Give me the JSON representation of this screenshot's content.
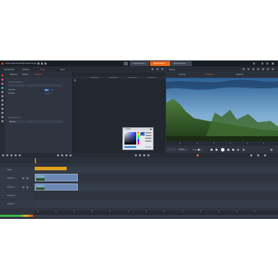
{
  "colors": {
    "accent": "#e86a1c",
    "panel": "#2e3440",
    "titlebar": "#1a1e25",
    "timeline_track_alt": "#353c49",
    "clip_title": "#e2a31c",
    "clip_video": "#6c88b5"
  },
  "menu": [
    "Datei",
    "Bearbeiten",
    "Einstellungen"
  ],
  "main_tabs": [
    {
      "label": "Importieren",
      "active": false
    },
    {
      "label": "Bearbeiten",
      "active": true
    },
    {
      "label": "Exportieren",
      "active": false
    }
  ],
  "library_tabs": [
    "Bibliothek",
    "Effekte",
    "Titel",
    "Text"
  ],
  "editor_tabs": [
    "Medien",
    "Effekt",
    "Objekt"
  ],
  "props": {
    "group1": "Titelvorgaben",
    "label1": "Schrift",
    "label2": "Größe",
    "group2": "Hintergrund",
    "select": "Farbe"
  },
  "color_dialog": {
    "title": "Farbe"
  },
  "player_title": "Player",
  "player_tabs": [
    "Quelle",
    "Timeline",
    "Vollbild"
  ],
  "track_names": [
    "Titel",
    "Video 1",
    "Audio 1",
    "Audio 2",
    "Video 2"
  ],
  "status": {
    "zoom": "100%"
  }
}
